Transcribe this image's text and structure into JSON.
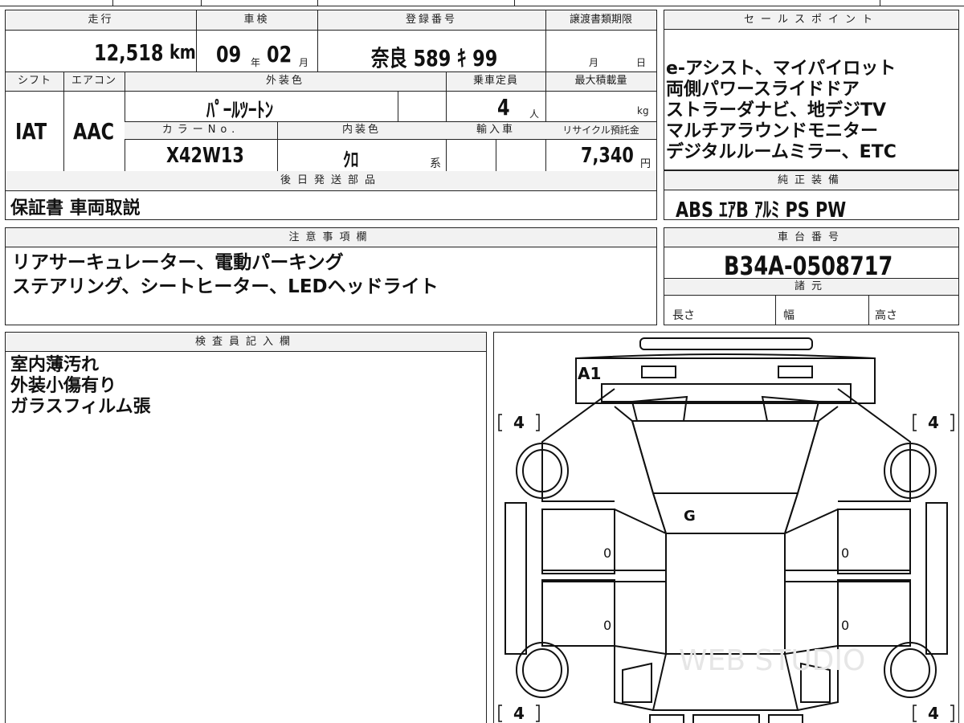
{
  "header": {
    "mileage_label": "走行",
    "mileage_value": "12,518",
    "mileage_unit": "km",
    "inspection_label": "車検",
    "inspection_year": "09",
    "inspection_year_unit": "年",
    "inspection_month": "02",
    "inspection_month_unit": "月",
    "registration_label": "登録番号",
    "registration_value": "奈良 589 ｷ 99",
    "transfer_label": "譲渡書類期限",
    "transfer_month_unit": "月",
    "transfer_day_unit": "日"
  },
  "spec": {
    "shift_label": "シフト",
    "shift_value": "IAT",
    "aircon_label": "エアコン",
    "aircon_value": "AAC",
    "exterior_color_label": "外装色",
    "exterior_color_value": "ﾊﾟｰﾙﾂｰﾄﾝ",
    "capacity_label": "乗車定員",
    "capacity_value": "4",
    "capacity_unit": "人",
    "max_load_label": "最大積載量",
    "max_load_unit": "kg",
    "color_no_label": "カラーNo.",
    "color_no_value": "X42W13",
    "interior_color_label": "内装色",
    "interior_color_value": "ｸﾛ",
    "interior_color_unit": "系",
    "import_label": "輸入車",
    "recycle_label": "リサイクル預託金",
    "recycle_value": "7,340",
    "recycle_unit": "円"
  },
  "later_parts": {
    "label": "後日発送部品",
    "value": "保証書 車両取説"
  },
  "sales_points": {
    "label": "セールスポイント",
    "lines": [
      "e-アシスト、マイパイロット",
      "両側パワースライドドア",
      "ストラーダナビ、地デジTV",
      "マルチアラウンドモニター",
      "デジタルルームミラー、ETC"
    ]
  },
  "genuine_equipment": {
    "label": "純正装備",
    "value": "ABS ｴｱB ｱﾙﾐ PS PW"
  },
  "notes": {
    "label": "注意事項欄",
    "lines": [
      "リアサーキュレーター、電動パーキング",
      "ステアリング、シートヒーター、LEDヘッドライト"
    ]
  },
  "chassis": {
    "label": "車台番号",
    "value": "B34A-0508717"
  },
  "dimensions": {
    "label": "諸元",
    "length_label": "長さ",
    "width_label": "幅",
    "height_label": "高さ"
  },
  "inspector": {
    "label": "検査員記入欄",
    "lines": [
      "室内薄汚れ",
      "外装小傷有り",
      "ガラスフィルム張"
    ]
  },
  "diagram": {
    "tire_left_front": "4",
    "tire_right_front": "4",
    "tire_left_rear": "4",
    "tire_right_rear": "4",
    "mark_front": "A1",
    "mark_glass": "G",
    "door_left_front": "0",
    "door_left_rear": "0",
    "door_right_front": "0",
    "door_right_rear": "0",
    "watermark": "WEB STUDIO"
  }
}
